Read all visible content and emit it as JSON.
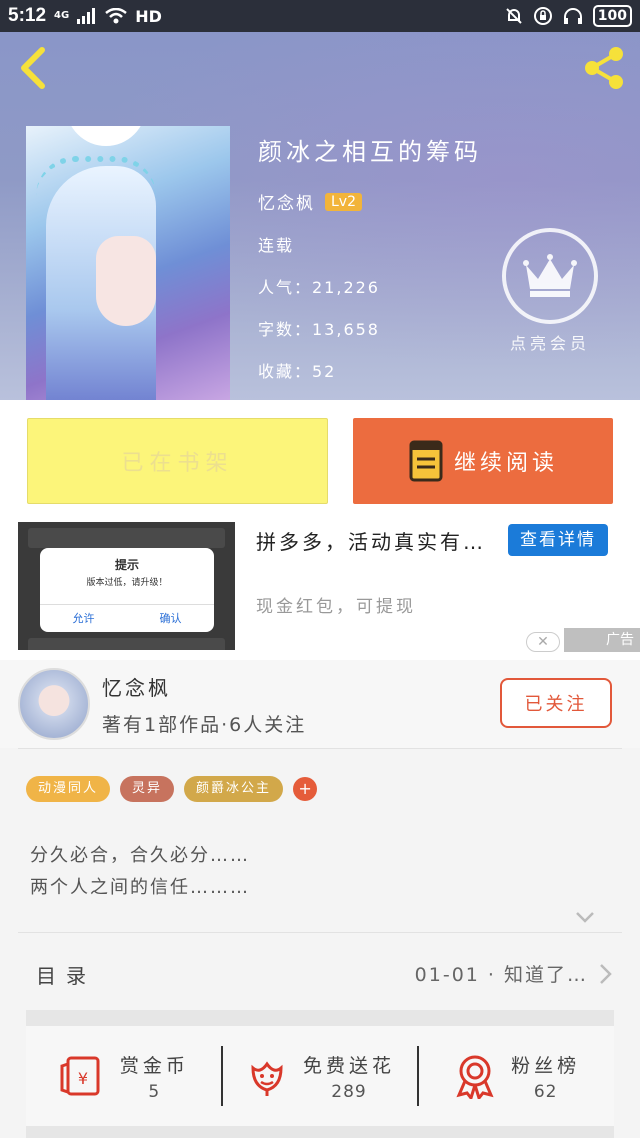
{
  "status_bar": {
    "time": "5:12",
    "network": "4G",
    "hd": "HD",
    "battery": "100"
  },
  "book": {
    "title": "颜冰之相互的筹码",
    "author": "忆念枫",
    "level": "Lv2",
    "status": "连载",
    "popularity": "人气：21,226",
    "word_count": "字数：13,658",
    "favorites": "收藏：52"
  },
  "vip": {
    "label": "点亮会员"
  },
  "actions": {
    "shelf_label": "已在书架",
    "read_label": "继续阅读"
  },
  "ad": {
    "dialog_title": "提示",
    "dialog_message": "版本过低，请升级！",
    "dialog_allow": "允许",
    "dialog_confirm": "确认",
    "title": "拼多多，活动真实有…",
    "detail_button": "查看详情",
    "description": "现金红包，可提现",
    "close": "✕",
    "tag": "广告"
  },
  "author_card": {
    "name": "忆念枫",
    "meta": "著有1部作品·6人关注",
    "follow_label": "已关注"
  },
  "tags": [
    {
      "label": "动漫同人",
      "color": "#f0b447"
    },
    {
      "label": "灵异",
      "color": "#c7735e"
    },
    {
      "label": "颜爵冰公主",
      "color": "#d2a84a"
    }
  ],
  "tag_add": "+",
  "description": {
    "line1": "分久必合，合久必分……",
    "line2": "两个人之间的信任………"
  },
  "catalog": {
    "title": "目录",
    "latest": "01-01 · 知道了…"
  },
  "bottom_stats": [
    {
      "label": "赏金币",
      "value": "5",
      "icon": "red-envelope-icon"
    },
    {
      "label": "免费送花",
      "value": "289",
      "icon": "flower-icon"
    },
    {
      "label": "粉丝榜",
      "value": "62",
      "icon": "award-ribbon-icon"
    }
  ],
  "colors": {
    "accent": "#ec6c3f",
    "follow": "#e2583a",
    "shelf": "#fcf57a",
    "ad_button": "#1b7bd9",
    "icon_red": "#d9382a"
  }
}
